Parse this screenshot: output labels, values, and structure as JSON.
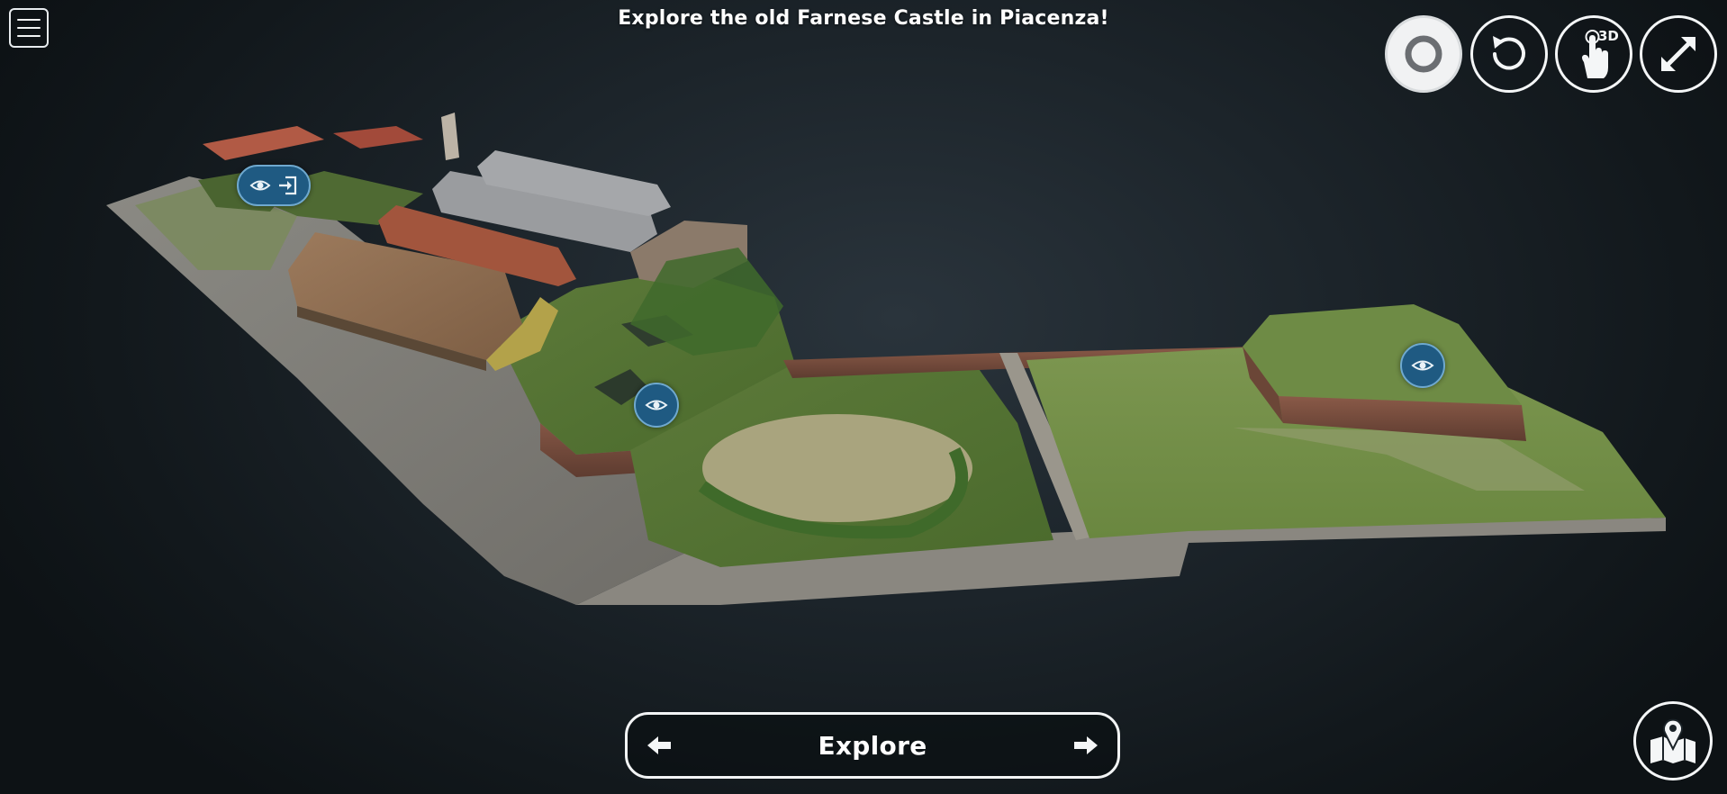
{
  "header": {
    "title": "Explore the old Farnese Castle in Piacenza!"
  },
  "menu": {
    "icon": "hamburger-menu-icon"
  },
  "toolbar": {
    "buttons": [
      {
        "icon": "camera-icon",
        "state": "active"
      },
      {
        "icon": "reset-rotate-icon",
        "state": "default"
      },
      {
        "icon": "touch-3d-icon",
        "state": "default",
        "badge": "3D"
      },
      {
        "icon": "fullscreen-expand-icon",
        "state": "default"
      }
    ]
  },
  "hotspots": [
    {
      "icons": [
        "eye-icon",
        "enter-icon"
      ]
    },
    {
      "icons": [
        "eye-icon"
      ]
    },
    {
      "icons": [
        "eye-icon"
      ]
    }
  ],
  "navigation": {
    "label": "Explore",
    "prev_icon": "arrow-left-icon",
    "next_icon": "arrow-right-icon"
  },
  "map_button": {
    "icon": "map-pin-icon"
  },
  "colors": {
    "background": "#1b2328",
    "hotspot_fill": "#1f5a82",
    "hotspot_border": "#6fa9cf",
    "ui_stroke": "#f4f6f7"
  }
}
